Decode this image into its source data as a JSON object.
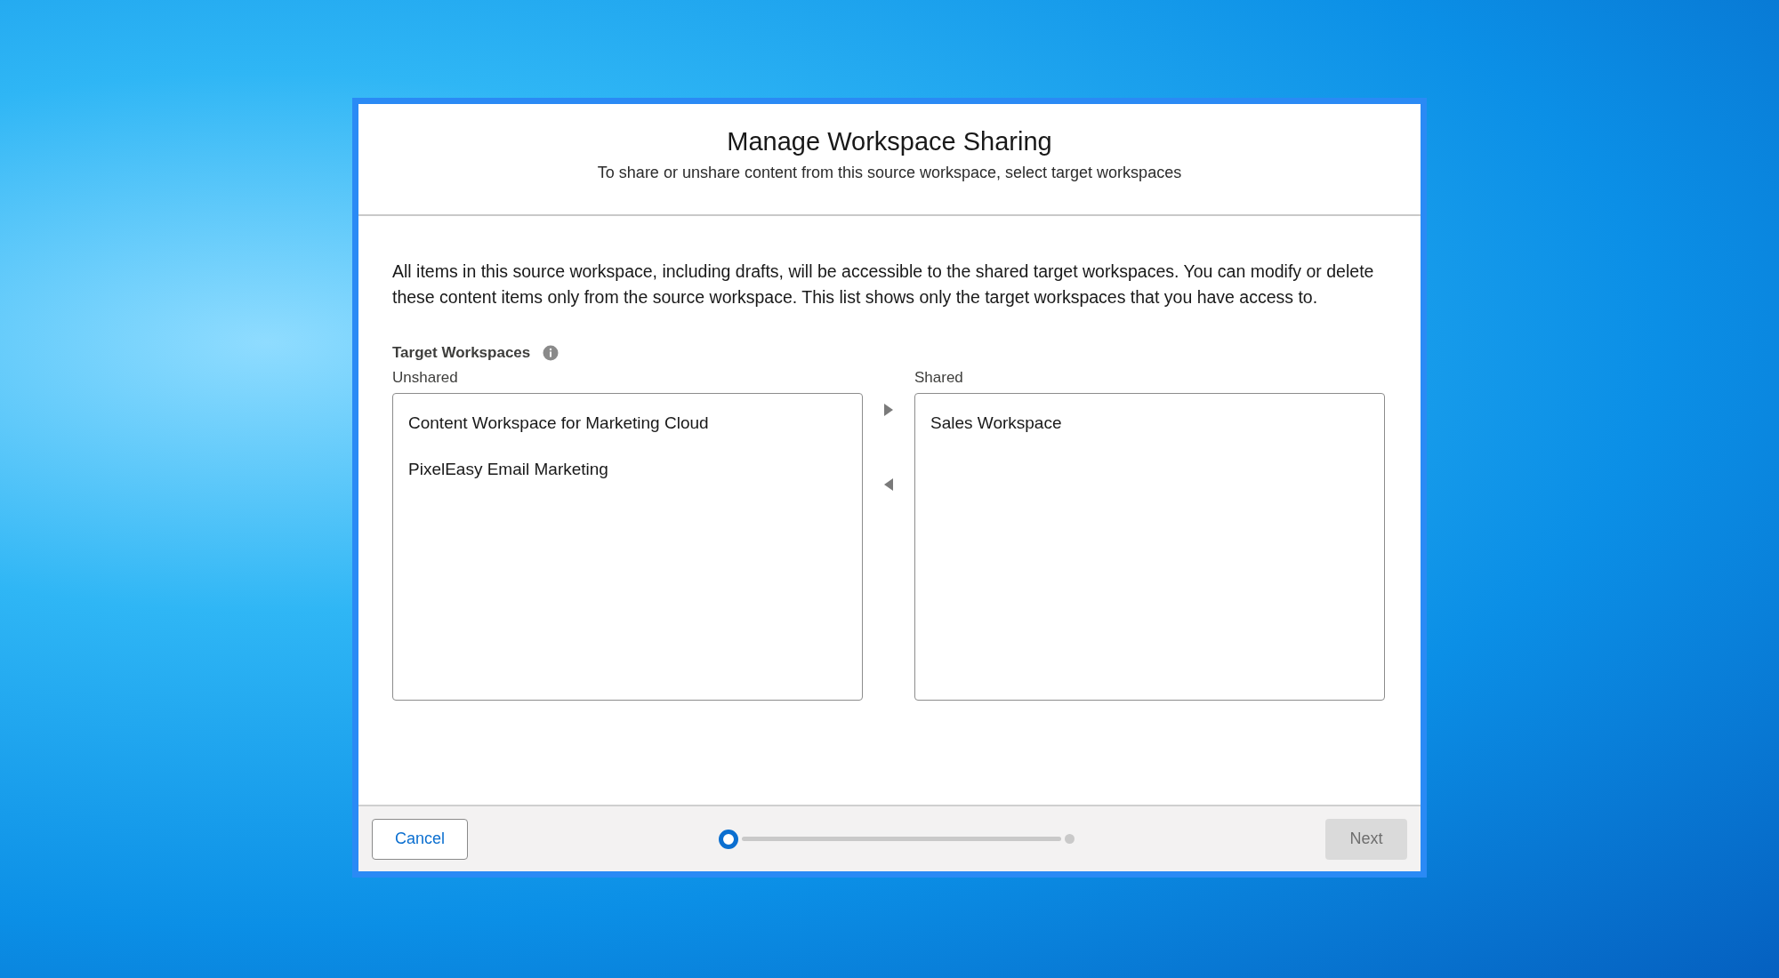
{
  "dialog": {
    "title": "Manage Workspace Sharing",
    "subtitle": "To share or unshare content from this source workspace, select target workspaces"
  },
  "description": "All items in this source workspace, including drafts, will be accessible to the shared target workspaces. You can modify or delete these content items only from the source workspace. This list shows only the target workspaces that you have access to.",
  "picker": {
    "label": "Target Workspaces",
    "unshared": {
      "label": "Unshared",
      "items": [
        {
          "label": "Content Workspace for Marketing Cloud",
          "selected": false
        },
        {
          "label": "PixelEasy Email Marketing",
          "selected": false
        }
      ]
    },
    "shared": {
      "label": "Shared",
      "items": [
        {
          "label": "Sales Workspace",
          "selected": false
        }
      ]
    }
  },
  "footer": {
    "cancel": "Cancel",
    "next": {
      "label": "Next",
      "disabled": true
    },
    "steps": [
      {
        "selected": true
      },
      {
        "selected": false
      }
    ]
  }
}
